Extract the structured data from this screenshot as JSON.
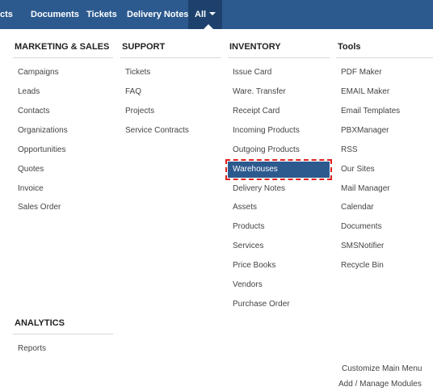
{
  "topbar": {
    "tabs": [
      {
        "label": "cts"
      },
      {
        "label": "Documents"
      },
      {
        "label": "Tickets"
      },
      {
        "label": "Delivery Notes"
      },
      {
        "label": "All"
      }
    ]
  },
  "menu": {
    "marketing": {
      "title": "MARKETING & SALES",
      "items": [
        "Campaigns",
        "Leads",
        "Contacts",
        "Organizations",
        "Opportunities",
        "Quotes",
        "Invoice",
        "Sales Order"
      ]
    },
    "support": {
      "title": "SUPPORT",
      "items": [
        "Tickets",
        "FAQ",
        "Projects",
        "Service Contracts"
      ]
    },
    "inventory": {
      "title": "INVENTORY",
      "items": [
        "Issue Card",
        "Ware. Transfer",
        "Receipt Card",
        "Incoming Products",
        "Outgoing Products",
        "Warehouses",
        "Delivery Notes",
        "Assets",
        "Products",
        "Services",
        "Price Books",
        "Vendors",
        "Purchase Order"
      ],
      "selected": "Warehouses"
    },
    "tools": {
      "title": "Tools",
      "items": [
        "PDF Maker",
        "EMAIL Maker",
        "Email Templates",
        "PBXManager",
        "RSS",
        "Our Sites",
        "Mail Manager",
        "Calendar",
        "Documents",
        "SMSNotifier",
        "Recycle Bin"
      ]
    },
    "analytics": {
      "title": "ANALYTICS",
      "items": [
        "Reports"
      ]
    }
  },
  "footer": {
    "customize": "Customize Main Menu",
    "modules": "Add / Manage Modules"
  },
  "colors": {
    "topbar": "#2c5a8f",
    "active_tab": "#1d416c",
    "selected_item": "#2c5a8f",
    "highlight_outline": "#e02020"
  }
}
